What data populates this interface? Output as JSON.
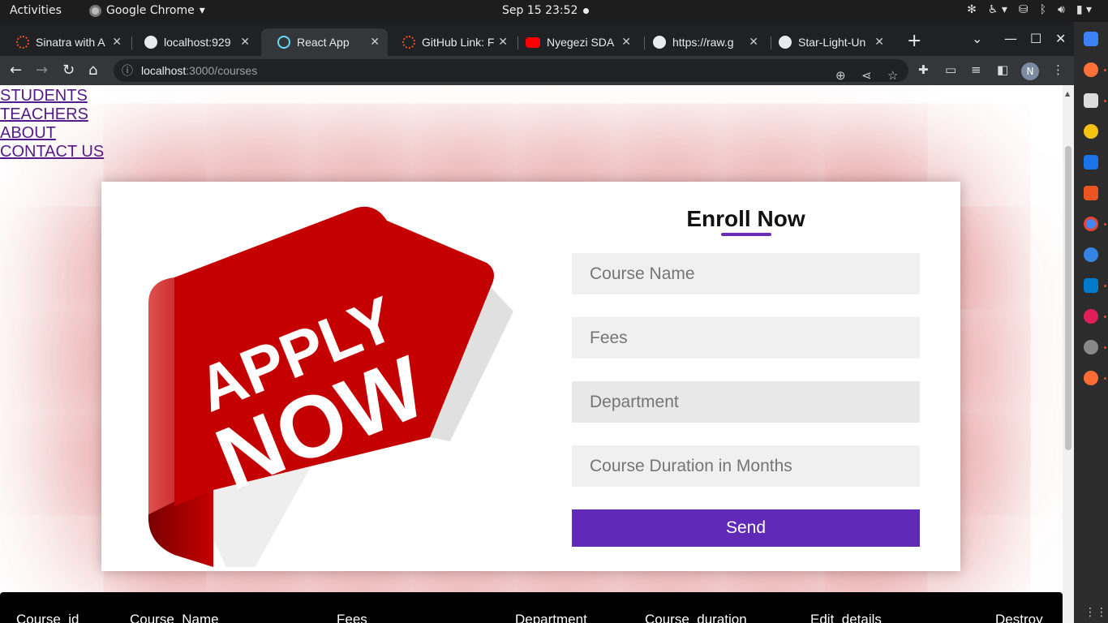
{
  "topbar": {
    "activities": "Activities",
    "app_name": "Google Chrome",
    "clock": "Sep 15  23:52"
  },
  "browser": {
    "tabs": [
      {
        "title": "Sinatra with A",
        "favicon_color": "#e95420"
      },
      {
        "title": "localhost:929",
        "favicon_color": "#e8eaed"
      },
      {
        "title": "React App",
        "favicon_color": "#61dafb"
      },
      {
        "title": "GitHub Link: F",
        "favicon_color": "#e95420"
      },
      {
        "title": "Nyegezi SDA",
        "favicon_color": "#ff0000"
      },
      {
        "title": "https://raw.g",
        "favicon_color": "#e8eaed"
      },
      {
        "title": "Star-Light-Un",
        "favicon_color": "#e8eaed"
      }
    ],
    "url_host": "localhost",
    "url_path": ":3000/courses",
    "profile_initial": "N"
  },
  "nav": {
    "links": [
      "STUDENTS",
      "TEACHERS",
      "ABOUT",
      "CONTACT US"
    ]
  },
  "banner": {
    "line1": "APPLY",
    "line2": "NOW"
  },
  "form": {
    "title": "Enroll Now",
    "course_name_placeholder": "Course Name",
    "fees_placeholder": "Fees",
    "department_placeholder": "Department",
    "duration_placeholder": "Course Duration in Months",
    "send_label": "Send"
  },
  "table": {
    "headers": [
      "Course_id",
      "Course_Name",
      "Fees",
      "Department",
      "Course_duration",
      "Edit_details",
      "Destroy"
    ]
  },
  "colors": {
    "accent": "#6129b8",
    "banner_red": "#c40000",
    "link": "#551a8b"
  }
}
